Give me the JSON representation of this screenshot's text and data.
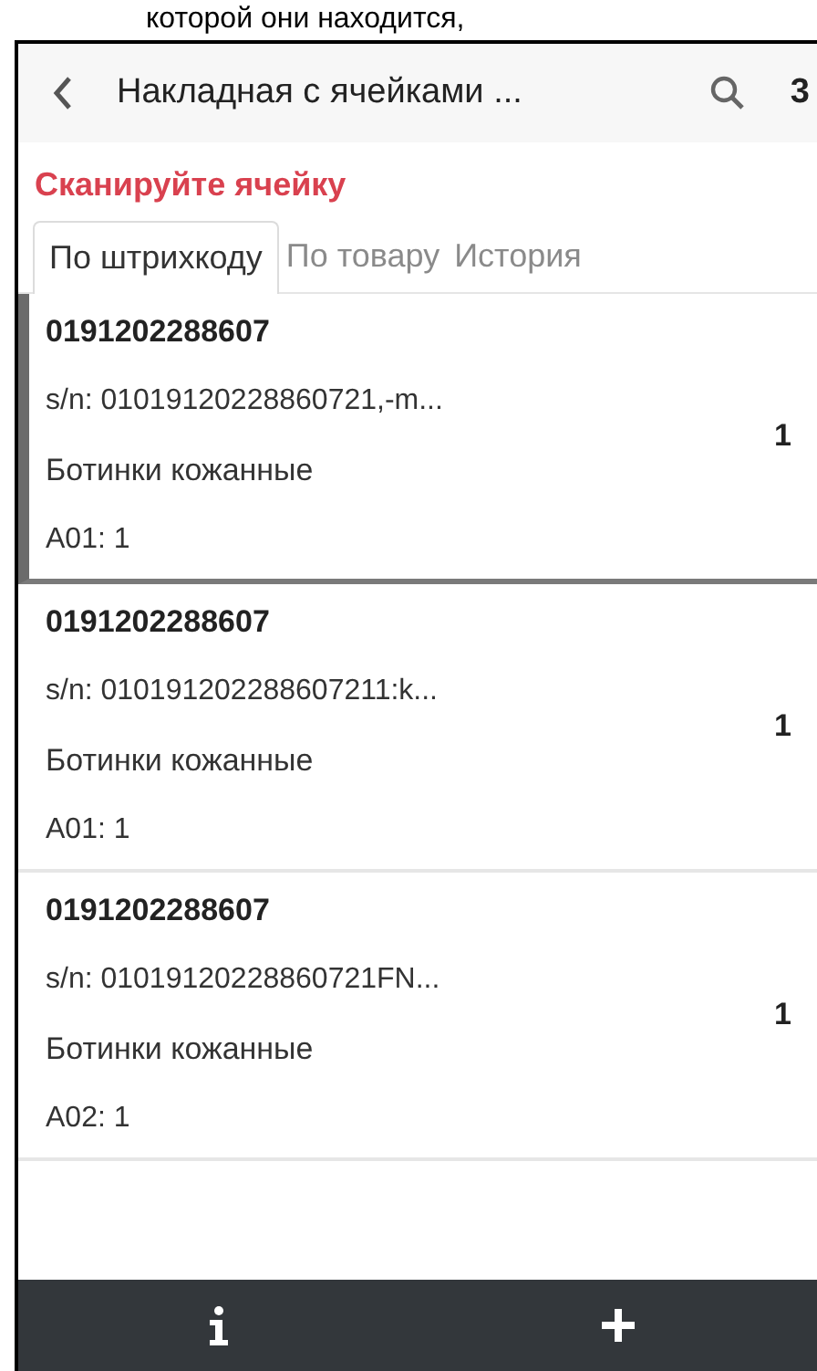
{
  "context_text": "которой они находится,",
  "app_bar": {
    "title": "Накладная с ячейками ...",
    "counter": "3"
  },
  "prompt": "Сканируйте ячейку",
  "tabs": [
    {
      "label": "По штрихкоду",
      "selected": true
    },
    {
      "label": "По товару",
      "selected": false
    },
    {
      "label": "История",
      "selected": false
    }
  ],
  "items": [
    {
      "barcode": "0191202288607",
      "serial": "s/n: 01019120228860721,-m...",
      "name": "Ботинки кожанные",
      "cell": "A01: 1",
      "quantity": "1",
      "selected": true
    },
    {
      "barcode": "0191202288607",
      "serial": "s/n: 010191202288607211:k...",
      "name": "Ботинки кожанные",
      "cell": "A01: 1",
      "quantity": "1",
      "selected": false
    },
    {
      "barcode": "0191202288607",
      "serial": "s/n: 01019120228860721FN...",
      "name": "Ботинки кожанные",
      "cell": "A02: 1",
      "quantity": "1",
      "selected": false
    }
  ]
}
